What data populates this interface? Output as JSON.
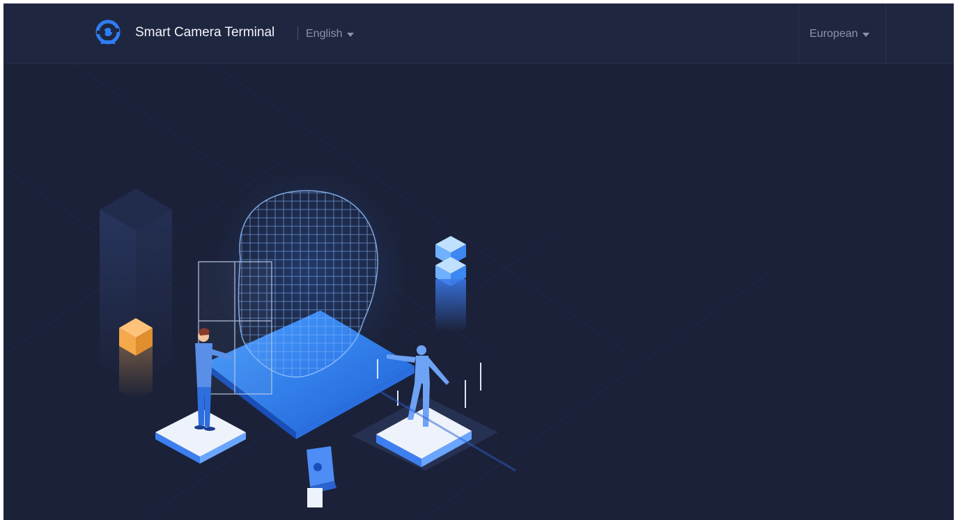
{
  "header": {
    "app_title": "Smart Camera Terminal",
    "language": {
      "selected": "English"
    },
    "region": {
      "selected": "European"
    }
  },
  "icons": {
    "logo": "camera-logo-icon",
    "language_caret": "caret-down-icon",
    "region_caret": "caret-down-icon"
  },
  "colors": {
    "background": "#1b2138",
    "header_background": "#1f2640",
    "accent": "#2f7df6",
    "title_text": "#f2f4f8",
    "muted_text": "#8b93ad",
    "cube_orange": "#f5a94a"
  }
}
